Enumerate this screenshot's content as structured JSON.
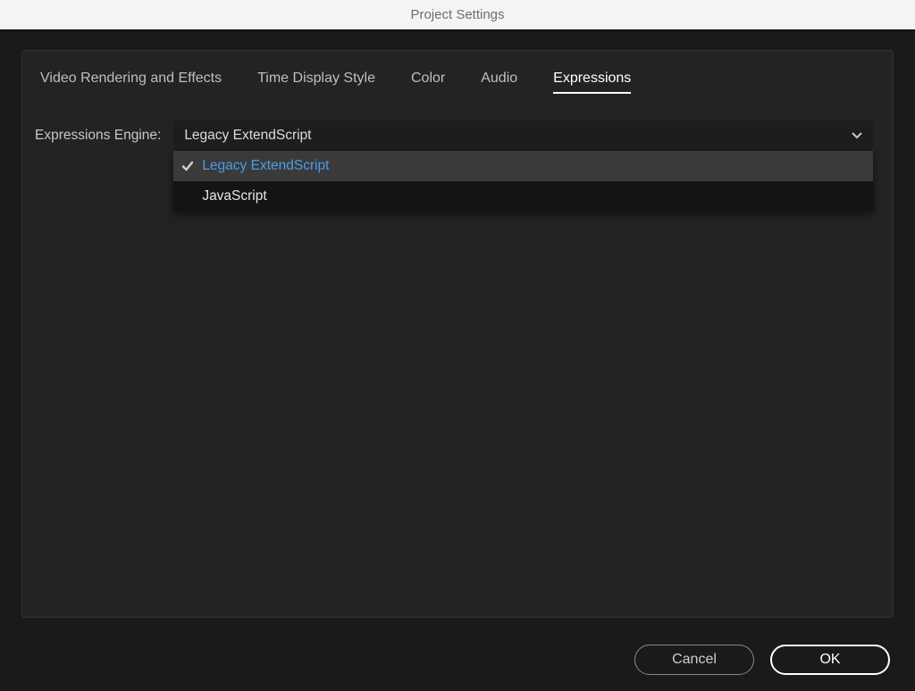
{
  "window": {
    "title": "Project Settings"
  },
  "tabs": [
    {
      "label": "Video Rendering and Effects",
      "active": false
    },
    {
      "label": "Time Display Style",
      "active": false
    },
    {
      "label": "Color",
      "active": false
    },
    {
      "label": "Audio",
      "active": false
    },
    {
      "label": "Expressions",
      "active": true
    }
  ],
  "field": {
    "label": "Expressions Engine:",
    "selected": "Legacy ExtendScript",
    "options": [
      {
        "label": "Legacy ExtendScript",
        "selectedMark": true,
        "highlight": true
      },
      {
        "label": "JavaScript",
        "selectedMark": false,
        "highlight": false
      }
    ]
  },
  "buttons": {
    "cancel": "Cancel",
    "ok": "OK"
  },
  "colors": {
    "accent": "#4a9ee8",
    "panel": "#232323",
    "bg": "#1a1a1a",
    "dropdown": "#141414"
  }
}
